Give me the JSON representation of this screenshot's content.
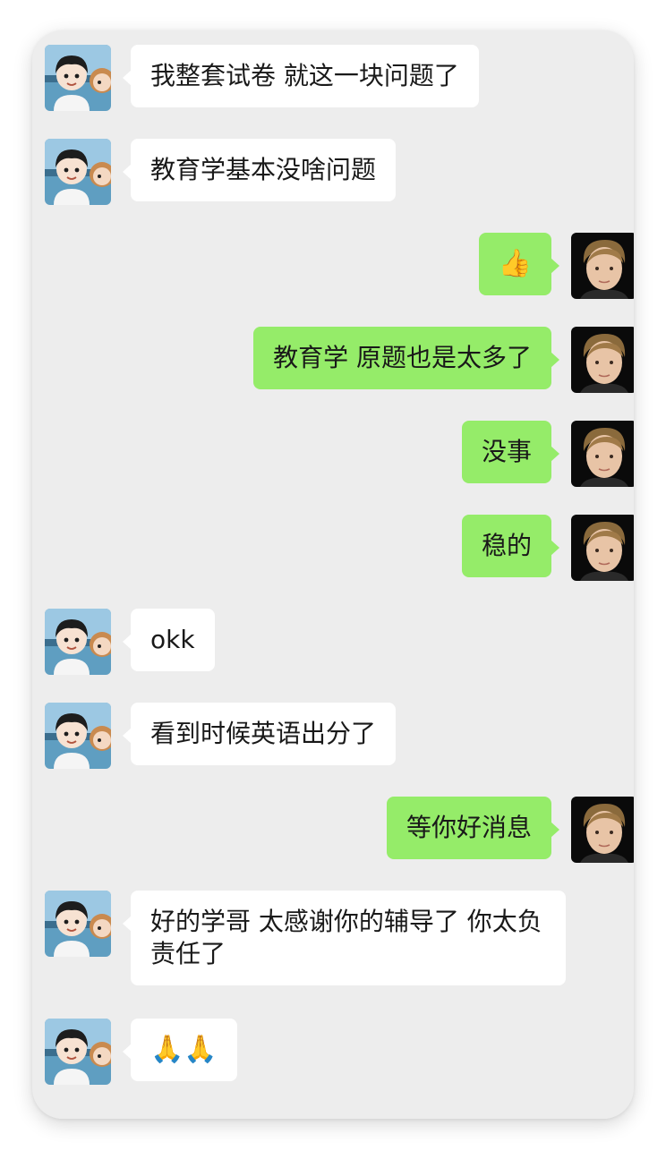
{
  "conversation": {
    "messages": [
      {
        "side": "left",
        "text": "我整套试卷 就这一块问题了"
      },
      {
        "side": "left",
        "text": "教育学基本没啥问题"
      },
      {
        "side": "right",
        "text": "👍",
        "emoji": "thumbs-up"
      },
      {
        "side": "right",
        "text": "教育学 原题也是太多了"
      },
      {
        "side": "right",
        "text": "没事"
      },
      {
        "side": "right",
        "text": "稳的"
      },
      {
        "side": "left",
        "text": "okk"
      },
      {
        "side": "left",
        "text": "看到时候英语出分了"
      },
      {
        "side": "right",
        "text": "等你好消息"
      },
      {
        "side": "left",
        "text": "好的学哥 太感谢你的辅导了 你太负责任了"
      },
      {
        "side": "left",
        "text": "🙏🙏",
        "emoji": "folded-hands"
      }
    ]
  },
  "colors": {
    "background": "#ededed",
    "incoming_bubble": "#ffffff",
    "outgoing_bubble": "#95ec69",
    "text": "#191919"
  },
  "avatars": {
    "incoming": "cartoon-couple-avatar",
    "outgoing": "portrait-photo-avatar"
  }
}
